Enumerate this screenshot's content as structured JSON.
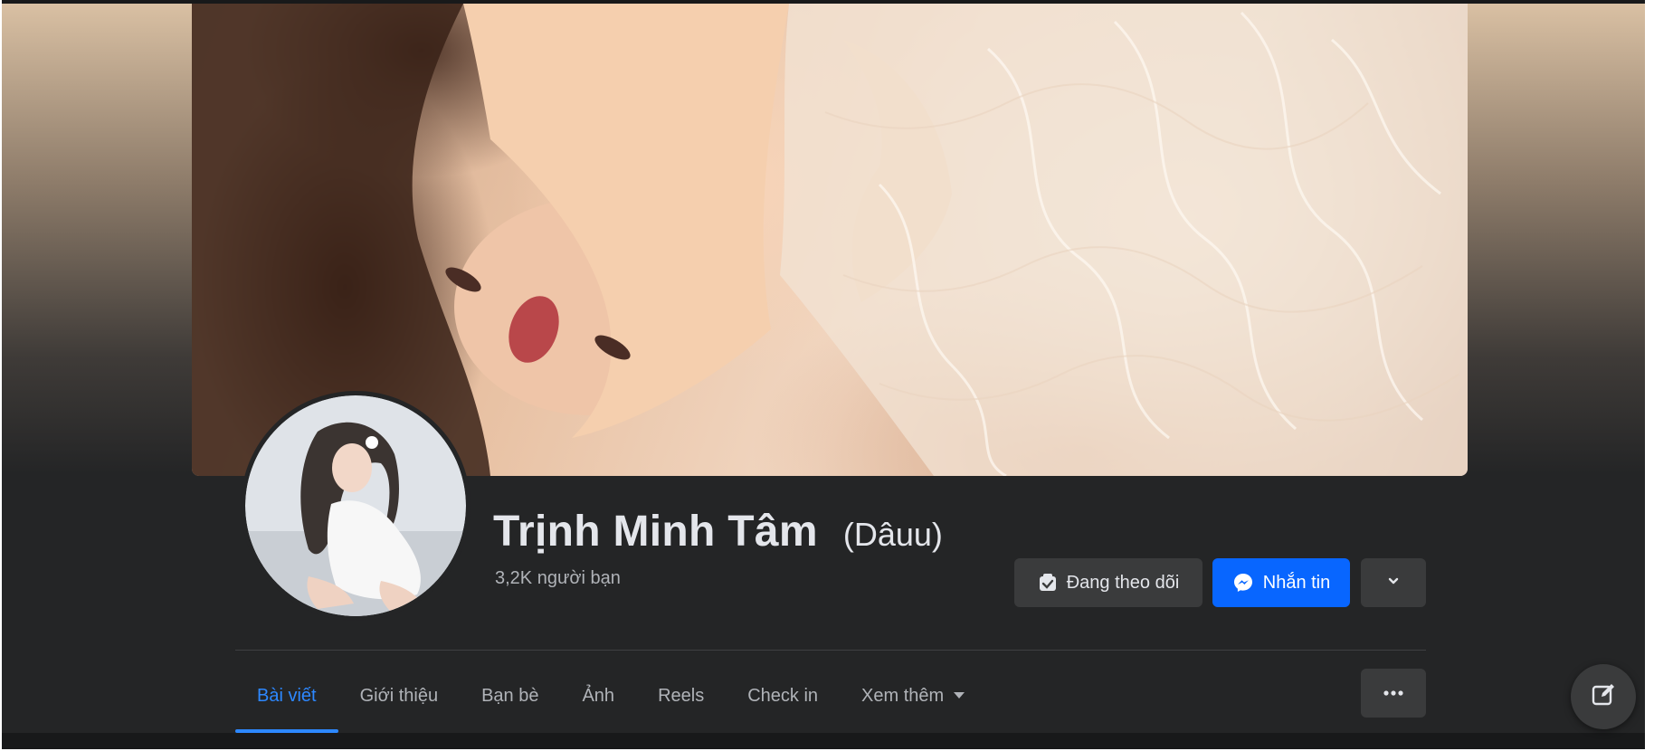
{
  "profile": {
    "name": "Trịnh Minh Tâm",
    "nickname": "(Dâuu)",
    "friends_count": "3,2K người bạn"
  },
  "actions": {
    "following_label": "Đang theo dõi",
    "message_label": "Nhắn tin"
  },
  "tabs": [
    {
      "label": "Bài viết",
      "active": true
    },
    {
      "label": "Giới thiệu",
      "active": false
    },
    {
      "label": "Bạn bè",
      "active": false
    },
    {
      "label": "Ảnh",
      "active": false
    },
    {
      "label": "Reels",
      "active": false
    },
    {
      "label": "Check in",
      "active": false
    },
    {
      "label": "Xem thêm",
      "active": false
    }
  ],
  "icons": {
    "following": "following-check-icon",
    "message": "messenger-icon",
    "more": "chevron-down-icon",
    "tab_more": "caret-down-icon",
    "tab_options": "ellipsis-icon",
    "compose": "edit-icon"
  },
  "colors": {
    "accent": "#0866ff",
    "active_tab": "#2d88ff",
    "surface": "#242526",
    "button": "#3a3b3c"
  }
}
